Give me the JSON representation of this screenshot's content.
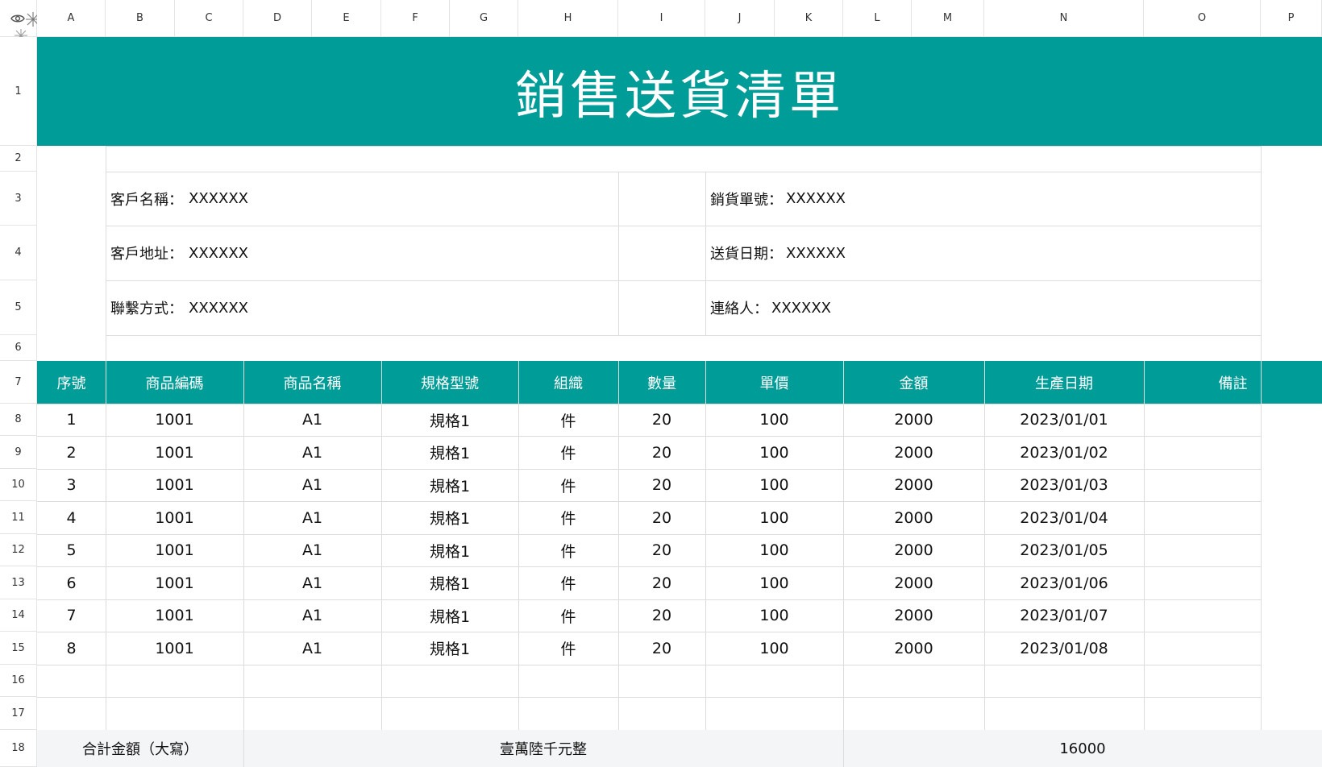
{
  "column_letters": [
    "A",
    "B",
    "C",
    "D",
    "E",
    "F",
    "G",
    "H",
    "I",
    "J",
    "K",
    "L",
    "M",
    "N",
    "O",
    "P"
  ],
  "row_numbers": [
    "1",
    "2",
    "3",
    "4",
    "5",
    "6",
    "7",
    "8",
    "9",
    "10",
    "11",
    "12",
    "13",
    "14",
    "15",
    "16",
    "17",
    "18"
  ],
  "title": "銷售送貨清單",
  "info": {
    "customer_name_label": "客戶名稱：",
    "customer_name_value": "XXXXXX",
    "customer_address_label": "客戶地址：",
    "customer_address_value": "XXXXXX",
    "contact_method_label": "聯繫方式：",
    "contact_method_value": "XXXXXX",
    "sales_no_label": "銷貨單號：",
    "sales_no_value": "XXXXXX",
    "delivery_date_label": "送貨日期：",
    "delivery_date_value": "XXXXXX",
    "contact_person_label": "連絡人：",
    "contact_person_value": "XXXXXX"
  },
  "table": {
    "headers": [
      "序號",
      "商品編碼",
      "商品名稱",
      "規格型號",
      "組織",
      "數量",
      "單價",
      "金額",
      "生產日期",
      "備註"
    ],
    "rows": [
      [
        "1",
        "1001",
        "A1",
        "規格1",
        "件",
        "20",
        "100",
        "2000",
        "2023/01/01",
        ""
      ],
      [
        "2",
        "1001",
        "A1",
        "規格1",
        "件",
        "20",
        "100",
        "2000",
        "2023/01/02",
        ""
      ],
      [
        "3",
        "1001",
        "A1",
        "規格1",
        "件",
        "20",
        "100",
        "2000",
        "2023/01/03",
        ""
      ],
      [
        "4",
        "1001",
        "A1",
        "規格1",
        "件",
        "20",
        "100",
        "2000",
        "2023/01/04",
        ""
      ],
      [
        "5",
        "1001",
        "A1",
        "規格1",
        "件",
        "20",
        "100",
        "2000",
        "2023/01/05",
        ""
      ],
      [
        "6",
        "1001",
        "A1",
        "規格1",
        "件",
        "20",
        "100",
        "2000",
        "2023/01/06",
        ""
      ],
      [
        "7",
        "1001",
        "A1",
        "規格1",
        "件",
        "20",
        "100",
        "2000",
        "2023/01/07",
        ""
      ],
      [
        "8",
        "1001",
        "A1",
        "規格1",
        "件",
        "20",
        "100",
        "2000",
        "2023/01/08",
        ""
      ]
    ]
  },
  "footer": {
    "total_label": "合計金額（大寫）",
    "total_in_words": "壹萬陸千元整",
    "total_value": "16000"
  },
  "colors": {
    "accent": "#009c97",
    "gridline": "#dcdcdc",
    "footer_bg": "#f4f5f7"
  },
  "icons": [
    "eye-icon",
    "freeze-icon"
  ]
}
